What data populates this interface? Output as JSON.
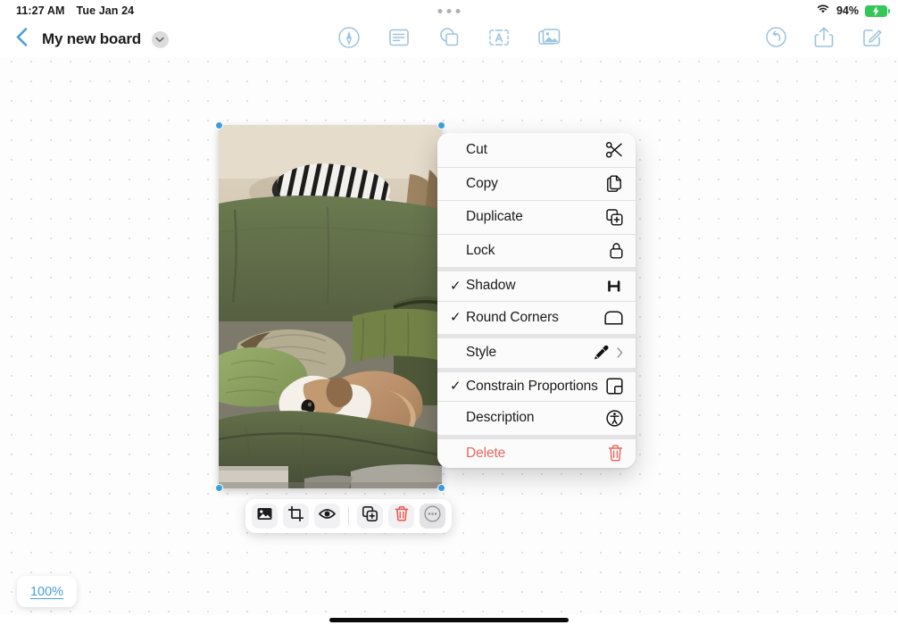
{
  "status_bar": {
    "time": "11:27 AM",
    "date": "Tue Jan 24",
    "battery_percent": "94%",
    "wifi_icon": "wifi-icon",
    "battery_icon": "battery-charging-icon",
    "multitask_handle": "multitasking-handle"
  },
  "nav": {
    "back_icon": "back-chevron-icon",
    "title": "My new board",
    "title_menu_icon": "chevron-down-icon",
    "center_tools": [
      {
        "name": "draw-tool",
        "icon": "pen-circle-icon"
      },
      {
        "name": "note-tool",
        "icon": "sticky-note-icon"
      },
      {
        "name": "shapes-tool",
        "icon": "shapes-icon"
      },
      {
        "name": "text-tool",
        "icon": "text-box-icon"
      },
      {
        "name": "media-tool",
        "icon": "photos-icon"
      }
    ],
    "right_tools": [
      {
        "name": "undo-button",
        "icon": "undo-icon"
      },
      {
        "name": "share-button",
        "icon": "share-icon"
      },
      {
        "name": "compose-button",
        "icon": "compose-icon"
      }
    ]
  },
  "context_menu": {
    "items": [
      {
        "label": "Cut",
        "icon": "scissors-icon",
        "checked": false,
        "group_start": false,
        "danger": false,
        "submenu": false
      },
      {
        "label": "Copy",
        "icon": "copy-icon",
        "checked": false,
        "group_start": false,
        "danger": false,
        "submenu": false
      },
      {
        "label": "Duplicate",
        "icon": "duplicate-icon",
        "checked": false,
        "group_start": false,
        "danger": false,
        "submenu": false
      },
      {
        "label": "Lock",
        "icon": "lock-icon",
        "checked": false,
        "group_start": false,
        "danger": false,
        "submenu": false
      },
      {
        "label": "Shadow",
        "icon": "shadow-icon",
        "checked": true,
        "group_start": true,
        "danger": false,
        "submenu": false
      },
      {
        "label": "Round Corners",
        "icon": "round-corners-icon",
        "checked": true,
        "group_start": false,
        "danger": false,
        "submenu": false
      },
      {
        "label": "Style",
        "icon": "eyedropper-icon",
        "checked": false,
        "group_start": true,
        "danger": false,
        "submenu": true
      },
      {
        "label": "Constrain Proportions",
        "icon": "constrain-icon",
        "checked": true,
        "group_start": true,
        "danger": false,
        "submenu": false
      },
      {
        "label": "Description",
        "icon": "accessibility-icon",
        "checked": false,
        "group_start": false,
        "danger": false,
        "submenu": false
      },
      {
        "label": "Delete",
        "icon": "trash-icon",
        "checked": false,
        "group_start": true,
        "danger": true,
        "submenu": false
      }
    ],
    "checkmark": "✓",
    "submenu_arrow": "›"
  },
  "element_toolbar": {
    "buttons": [
      {
        "name": "replace-image-button",
        "icon": "image-icon",
        "state": "normal"
      },
      {
        "name": "crop-button",
        "icon": "crop-icon",
        "state": "normal"
      },
      {
        "name": "preview-button",
        "icon": "eye-icon",
        "state": "normal"
      },
      {
        "name": "duplicate-button",
        "icon": "duplicate-icon",
        "state": "normal"
      },
      {
        "name": "delete-button",
        "icon": "trash-icon",
        "state": "danger"
      },
      {
        "name": "more-button",
        "icon": "ellipsis-circle-icon",
        "state": "active"
      }
    ]
  },
  "zoom": {
    "level": "100%"
  },
  "canvas": {
    "selected_element": "photo-dog-on-green-couch",
    "selection_handles": [
      "top-left",
      "top-right",
      "bottom-left",
      "bottom-right"
    ]
  },
  "colors": {
    "accent_blue": "#3b9fe0",
    "danger_red": "#e8665f",
    "battery_green": "#34c759",
    "tool_tint": "#9cc4dd"
  }
}
